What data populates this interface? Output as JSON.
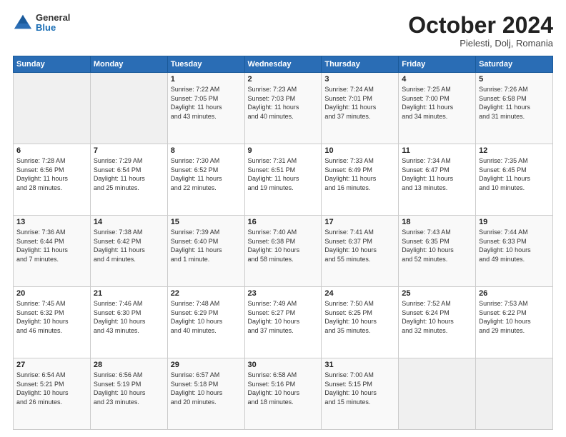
{
  "header": {
    "logo": {
      "general": "General",
      "blue": "Blue"
    },
    "title": "October 2024",
    "location": "Pielesti, Dolj, Romania"
  },
  "weekdays": [
    "Sunday",
    "Monday",
    "Tuesday",
    "Wednesday",
    "Thursday",
    "Friday",
    "Saturday"
  ],
  "weeks": [
    [
      {
        "day": "",
        "info": ""
      },
      {
        "day": "",
        "info": ""
      },
      {
        "day": "1",
        "info": "Sunrise: 7:22 AM\nSunset: 7:05 PM\nDaylight: 11 hours\nand 43 minutes."
      },
      {
        "day": "2",
        "info": "Sunrise: 7:23 AM\nSunset: 7:03 PM\nDaylight: 11 hours\nand 40 minutes."
      },
      {
        "day": "3",
        "info": "Sunrise: 7:24 AM\nSunset: 7:01 PM\nDaylight: 11 hours\nand 37 minutes."
      },
      {
        "day": "4",
        "info": "Sunrise: 7:25 AM\nSunset: 7:00 PM\nDaylight: 11 hours\nand 34 minutes."
      },
      {
        "day": "5",
        "info": "Sunrise: 7:26 AM\nSunset: 6:58 PM\nDaylight: 11 hours\nand 31 minutes."
      }
    ],
    [
      {
        "day": "6",
        "info": "Sunrise: 7:28 AM\nSunset: 6:56 PM\nDaylight: 11 hours\nand 28 minutes."
      },
      {
        "day": "7",
        "info": "Sunrise: 7:29 AM\nSunset: 6:54 PM\nDaylight: 11 hours\nand 25 minutes."
      },
      {
        "day": "8",
        "info": "Sunrise: 7:30 AM\nSunset: 6:52 PM\nDaylight: 11 hours\nand 22 minutes."
      },
      {
        "day": "9",
        "info": "Sunrise: 7:31 AM\nSunset: 6:51 PM\nDaylight: 11 hours\nand 19 minutes."
      },
      {
        "day": "10",
        "info": "Sunrise: 7:33 AM\nSunset: 6:49 PM\nDaylight: 11 hours\nand 16 minutes."
      },
      {
        "day": "11",
        "info": "Sunrise: 7:34 AM\nSunset: 6:47 PM\nDaylight: 11 hours\nand 13 minutes."
      },
      {
        "day": "12",
        "info": "Sunrise: 7:35 AM\nSunset: 6:45 PM\nDaylight: 11 hours\nand 10 minutes."
      }
    ],
    [
      {
        "day": "13",
        "info": "Sunrise: 7:36 AM\nSunset: 6:44 PM\nDaylight: 11 hours\nand 7 minutes."
      },
      {
        "day": "14",
        "info": "Sunrise: 7:38 AM\nSunset: 6:42 PM\nDaylight: 11 hours\nand 4 minutes."
      },
      {
        "day": "15",
        "info": "Sunrise: 7:39 AM\nSunset: 6:40 PM\nDaylight: 11 hours\nand 1 minute."
      },
      {
        "day": "16",
        "info": "Sunrise: 7:40 AM\nSunset: 6:38 PM\nDaylight: 10 hours\nand 58 minutes."
      },
      {
        "day": "17",
        "info": "Sunrise: 7:41 AM\nSunset: 6:37 PM\nDaylight: 10 hours\nand 55 minutes."
      },
      {
        "day": "18",
        "info": "Sunrise: 7:43 AM\nSunset: 6:35 PM\nDaylight: 10 hours\nand 52 minutes."
      },
      {
        "day": "19",
        "info": "Sunrise: 7:44 AM\nSunset: 6:33 PM\nDaylight: 10 hours\nand 49 minutes."
      }
    ],
    [
      {
        "day": "20",
        "info": "Sunrise: 7:45 AM\nSunset: 6:32 PM\nDaylight: 10 hours\nand 46 minutes."
      },
      {
        "day": "21",
        "info": "Sunrise: 7:46 AM\nSunset: 6:30 PM\nDaylight: 10 hours\nand 43 minutes."
      },
      {
        "day": "22",
        "info": "Sunrise: 7:48 AM\nSunset: 6:29 PM\nDaylight: 10 hours\nand 40 minutes."
      },
      {
        "day": "23",
        "info": "Sunrise: 7:49 AM\nSunset: 6:27 PM\nDaylight: 10 hours\nand 37 minutes."
      },
      {
        "day": "24",
        "info": "Sunrise: 7:50 AM\nSunset: 6:25 PM\nDaylight: 10 hours\nand 35 minutes."
      },
      {
        "day": "25",
        "info": "Sunrise: 7:52 AM\nSunset: 6:24 PM\nDaylight: 10 hours\nand 32 minutes."
      },
      {
        "day": "26",
        "info": "Sunrise: 7:53 AM\nSunset: 6:22 PM\nDaylight: 10 hours\nand 29 minutes."
      }
    ],
    [
      {
        "day": "27",
        "info": "Sunrise: 6:54 AM\nSunset: 5:21 PM\nDaylight: 10 hours\nand 26 minutes."
      },
      {
        "day": "28",
        "info": "Sunrise: 6:56 AM\nSunset: 5:19 PM\nDaylight: 10 hours\nand 23 minutes."
      },
      {
        "day": "29",
        "info": "Sunrise: 6:57 AM\nSunset: 5:18 PM\nDaylight: 10 hours\nand 20 minutes."
      },
      {
        "day": "30",
        "info": "Sunrise: 6:58 AM\nSunset: 5:16 PM\nDaylight: 10 hours\nand 18 minutes."
      },
      {
        "day": "31",
        "info": "Sunrise: 7:00 AM\nSunset: 5:15 PM\nDaylight: 10 hours\nand 15 minutes."
      },
      {
        "day": "",
        "info": ""
      },
      {
        "day": "",
        "info": ""
      }
    ]
  ]
}
